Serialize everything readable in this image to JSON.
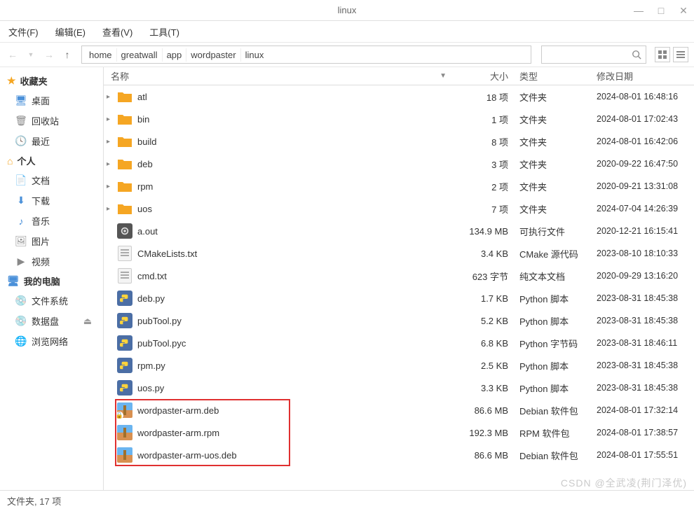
{
  "window": {
    "title": "linux"
  },
  "menu": {
    "file": "文件(F)",
    "edit": "编辑(E)",
    "view": "查看(V)",
    "tools": "工具(T)"
  },
  "breadcrumb": [
    "home",
    "greatwall",
    "app",
    "wordpaster",
    "linux"
  ],
  "columns": {
    "name": "名称",
    "size": "大小",
    "type": "类型",
    "date": "修改日期"
  },
  "sidebar": {
    "favorites": {
      "label": "收藏夹",
      "items": [
        {
          "icon": "desktop",
          "label": "桌面"
        },
        {
          "icon": "trash",
          "label": "回收站"
        },
        {
          "icon": "clock",
          "label": "最近"
        }
      ]
    },
    "personal": {
      "label": "个人",
      "items": [
        {
          "icon": "doc",
          "label": "文档"
        },
        {
          "icon": "down",
          "label": "下载"
        },
        {
          "icon": "music",
          "label": "音乐"
        },
        {
          "icon": "pic",
          "label": "图片"
        },
        {
          "icon": "video",
          "label": "视频"
        }
      ]
    },
    "computer": {
      "label": "我的电脑",
      "items": [
        {
          "icon": "disk",
          "label": "文件系统"
        },
        {
          "icon": "disk",
          "label": "数据盘",
          "eject": true
        },
        {
          "icon": "net",
          "label": "浏览网络"
        }
      ]
    }
  },
  "files": [
    {
      "kind": "folder",
      "name": "atl",
      "size": "18 项",
      "type": "文件夹",
      "date": "2024-08-01 16:48:16",
      "expand": true
    },
    {
      "kind": "folder",
      "name": "bin",
      "size": "1 项",
      "type": "文件夹",
      "date": "2024-08-01 17:02:43",
      "expand": true
    },
    {
      "kind": "folder",
      "name": "build",
      "size": "8 项",
      "type": "文件夹",
      "date": "2024-08-01 16:42:06",
      "expand": true
    },
    {
      "kind": "folder",
      "name": "deb",
      "size": "3 项",
      "type": "文件夹",
      "date": "2020-09-22 16:47:50",
      "expand": true
    },
    {
      "kind": "folder",
      "name": "rpm",
      "size": "2 项",
      "type": "文件夹",
      "date": "2020-09-21 13:31:08",
      "expand": true
    },
    {
      "kind": "folder",
      "name": "uos",
      "size": "7 项",
      "type": "文件夹",
      "date": "2024-07-04 14:26:39",
      "expand": true
    },
    {
      "kind": "exe",
      "name": "a.out",
      "size": "134.9 MB",
      "type": "可执行文件",
      "date": "2020-12-21 16:15:41"
    },
    {
      "kind": "txt",
      "name": "CMakeLists.txt",
      "size": "3.4 KB",
      "type": "CMake 源代码",
      "date": "2023-08-10 18:10:33"
    },
    {
      "kind": "txt",
      "name": "cmd.txt",
      "size": "623 字节",
      "type": "纯文本文档",
      "date": "2020-09-29 13:16:20"
    },
    {
      "kind": "py",
      "name": "deb.py",
      "size": "1.7 KB",
      "type": "Python 脚本",
      "date": "2023-08-31 18:45:38"
    },
    {
      "kind": "py",
      "name": "pubTool.py",
      "size": "5.2 KB",
      "type": "Python 脚本",
      "date": "2023-08-31 18:45:38"
    },
    {
      "kind": "py",
      "name": "pubTool.pyc",
      "size": "6.8 KB",
      "type": "Python 字节码",
      "date": "2023-08-31 18:46:11"
    },
    {
      "kind": "py",
      "name": "rpm.py",
      "size": "2.5 KB",
      "type": "Python 脚本",
      "date": "2023-08-31 18:45:38"
    },
    {
      "kind": "py",
      "name": "uos.py",
      "size": "3.3 KB",
      "type": "Python 脚本",
      "date": "2023-08-31 18:45:38"
    },
    {
      "kind": "pkg",
      "name": "wordpaster-arm.deb",
      "size": "86.6 MB",
      "type": "Debian 软件包",
      "date": "2024-08-01 17:32:14",
      "lock": true
    },
    {
      "kind": "pkg",
      "name": "wordpaster-arm.rpm",
      "size": "192.3 MB",
      "type": "RPM 软件包",
      "date": "2024-08-01 17:38:57"
    },
    {
      "kind": "pkg",
      "name": "wordpaster-arm-uos.deb",
      "size": "86.6 MB",
      "type": "Debian 软件包",
      "date": "2024-08-01 17:55:51"
    }
  ],
  "status": "文件夹, 17 项",
  "watermark": "CSDN @全武凌(荆门泽优)",
  "highlight": {
    "startIndex": 14,
    "endIndex": 16
  }
}
